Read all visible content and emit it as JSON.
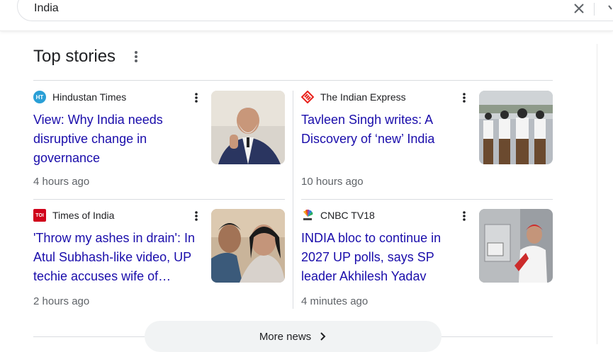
{
  "search": {
    "query": "India"
  },
  "section": {
    "title": "Top stories"
  },
  "stories": [
    {
      "source": "Hindustan Times",
      "headline": "View: Why India needs disruptive change in governance",
      "time": "4 hours ago"
    },
    {
      "source": "The Indian Express",
      "headline": "Tavleen Singh writes: A Discovery of ‘new’ India",
      "time": "10 hours ago"
    },
    {
      "source": "Times of India",
      "headline": "'Throw my ashes in drain': In Atul Subhash-like video, UP techie accuses wife of…",
      "time": "2 hours ago"
    },
    {
      "source": "CNBC TV18",
      "headline": "INDIA bloc to continue in 2027 UP polls, says SP leader Akhilesh Yadav",
      "time": "4 minutes ago"
    }
  ],
  "favicons": {
    "ht": "HT",
    "toi": "TOI"
  },
  "more": {
    "label": "More news"
  },
  "colors": {
    "link": "#1a0dab",
    "meta": "#5f6368",
    "divider": "#dadce0"
  }
}
